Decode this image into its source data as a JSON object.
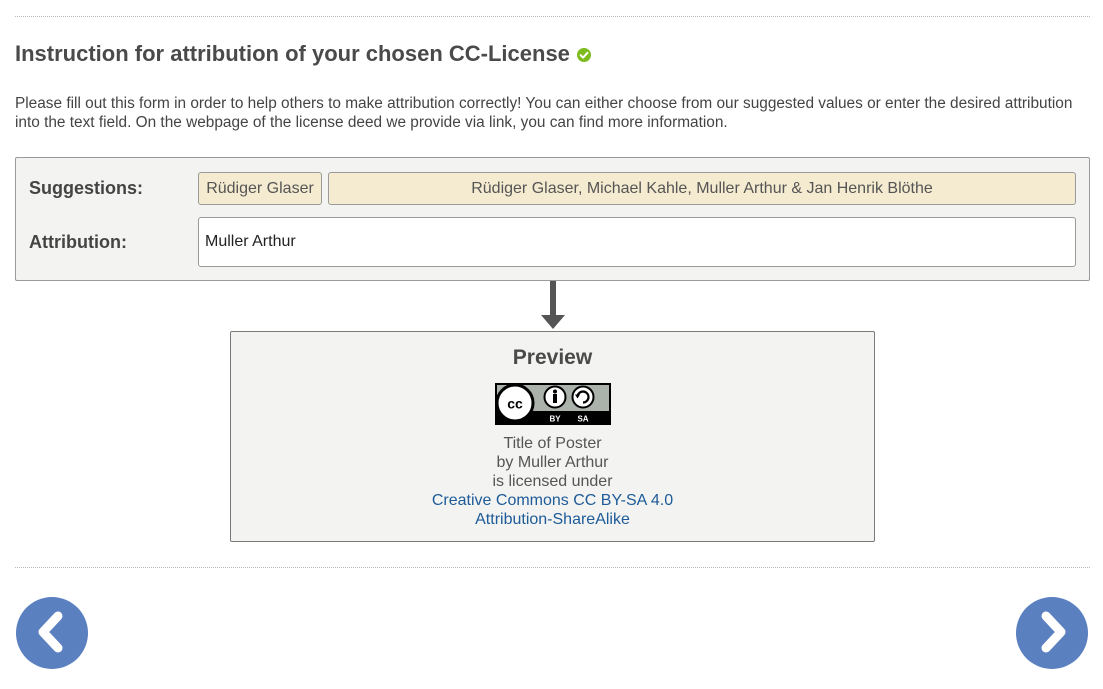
{
  "heading": {
    "title": "Instruction for attribution of your chosen CC-License",
    "status_icon": "check-circle-icon",
    "status_color": "#7dbb1e"
  },
  "intro": "Please fill out this form in order to help others to make attribution correctly! You can either choose from our suggested values or enter the desired attribution into the text field. On the webpage of the license deed we provide via link, you can find more information.",
  "form": {
    "suggestions_label": "Suggestions:",
    "suggestions": [
      "Rüdiger Glaser",
      "Rüdiger Glaser, Michael Kahle, Muller Arthur & Jan Henrik Blöthe"
    ],
    "attribution_label": "Attribution:",
    "attribution_value": "Muller Arthur"
  },
  "preview": {
    "title": "Preview",
    "badge": {
      "icon": "cc-by-sa-badge-icon",
      "by_text": "BY",
      "sa_text": "SA"
    },
    "work_title": "Title of Poster",
    "by_line": "by Muller Arthur",
    "licensed_text": "is licensed under",
    "license_name": "Creative Commons CC BY-SA 4.0",
    "license_type": "Attribution-ShareAlike"
  },
  "navigation": {
    "prev_icon": "chevron-left-icon",
    "next_icon": "chevron-right-icon",
    "button_color": "#5a80c0"
  },
  "colors": {
    "suggestion_bg": "#f4ebd0",
    "panel_bg": "#f3f3f1",
    "link": "#1d5b99"
  }
}
